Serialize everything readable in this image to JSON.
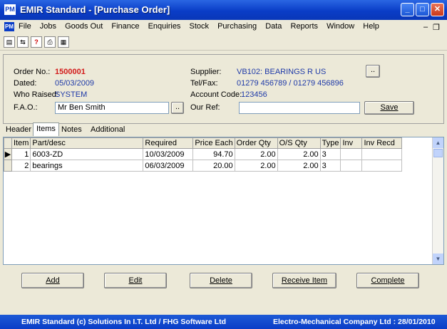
{
  "window": {
    "title": "EMIR Standard - [Purchase Order]",
    "app_icon": "PM",
    "controls": [
      "minimize",
      "maximize",
      "close"
    ]
  },
  "menu": {
    "items": [
      "File",
      "Jobs",
      "Goods Out",
      "Finance",
      "Enquiries",
      "Stock",
      "Purchasing",
      "Data",
      "Reports",
      "Window",
      "Help"
    ]
  },
  "toolbar": {
    "icons": [
      "document-icon",
      "switch-icon",
      "help-icon",
      "printer-icon",
      "calculator-icon"
    ]
  },
  "order": {
    "order_no_label": "Order No.:",
    "order_no": "1500001",
    "dated_label": "Dated:",
    "dated": "05/03/2009",
    "who_raised_label": "Who Raised:",
    "who_raised": "SYSTEM",
    "fao_label": "F.A.O.:",
    "fao": "Mr Ben Smith",
    "supplier_label": "Supplier:",
    "supplier": "VB102: BEARINGS R US",
    "telfax_label": "Tel/Fax:",
    "telfax": "01279 456789 / 01279 456896",
    "account_code_label": "Account Code:",
    "account_code": "123456",
    "our_ref_label": "Our Ref:",
    "our_ref": "",
    "ellipsis": "..",
    "save_label": "Save"
  },
  "tabs": [
    "Header",
    "Items",
    "Notes",
    "Additional"
  ],
  "active_tab": "Items",
  "grid": {
    "columns": [
      "Item",
      "Part/desc",
      "Required",
      "Price Each",
      "Order Qty",
      "O/S Qty",
      "Type",
      "Inv",
      "Inv Recd"
    ],
    "rows": [
      {
        "item": "1",
        "part": "6003-ZD",
        "required": "10/03/2009",
        "price": "94.70",
        "order_qty": "2.00",
        "os_qty": "2.00",
        "type": "3",
        "inv": "",
        "inv_recd": ""
      },
      {
        "item": "2",
        "part": "bearings",
        "required": "06/03/2009",
        "price": "20.00",
        "order_qty": "2.00",
        "os_qty": "2.00",
        "type": "3",
        "inv": "",
        "inv_recd": ""
      }
    ]
  },
  "actions": {
    "add": "Add",
    "edit": "Edit",
    "delete": "Delete",
    "receive": "Receive Item",
    "complete": "Complete"
  },
  "status": {
    "left": "EMIR Standard (c) Solutions In I.T. Ltd / FHG Software Ltd",
    "right": "Electro-Mechanical Company Ltd : 28/01/2010"
  },
  "colors": {
    "title_bar": "#0a3dc7",
    "order_no": "#d21a1a",
    "value_text": "#1f3aa8",
    "status_bar": "#0a3dc7"
  }
}
